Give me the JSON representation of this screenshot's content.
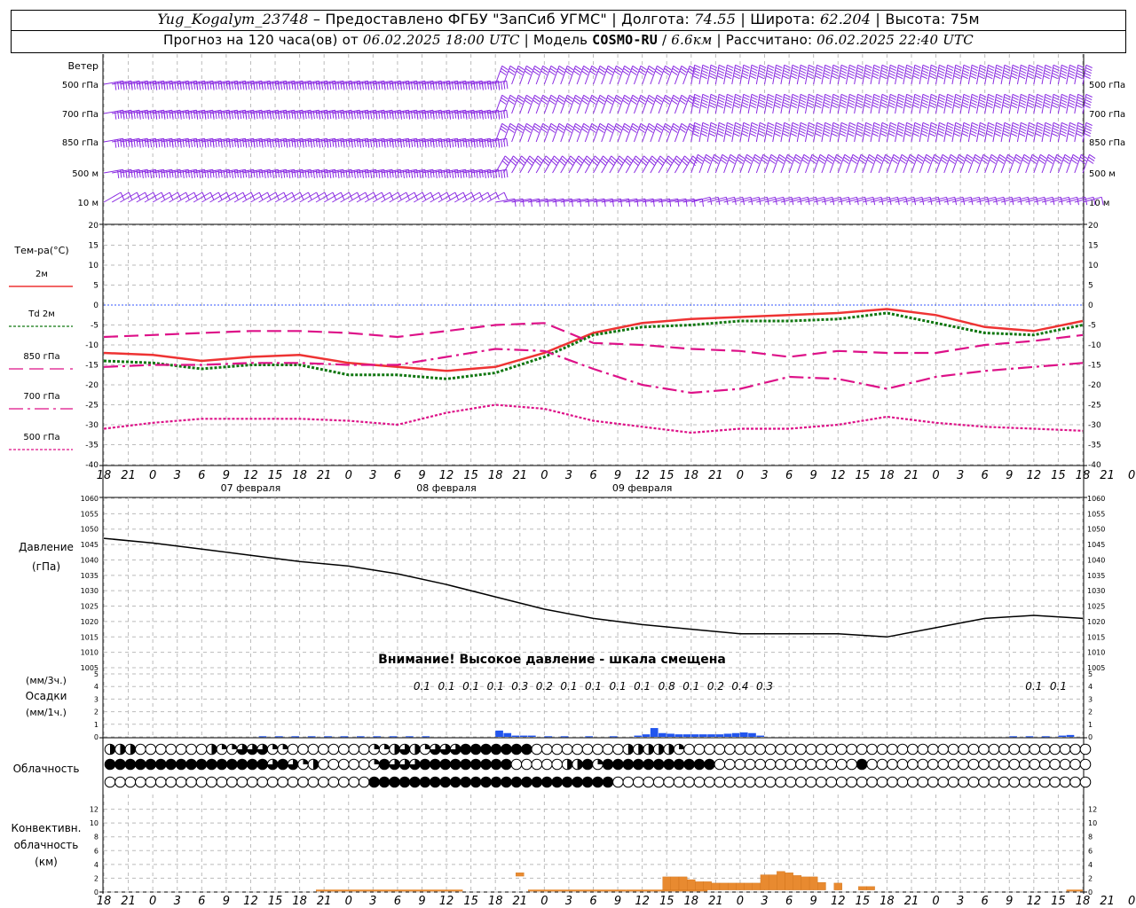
{
  "header": {
    "station": "Yug_Kogalym_23748",
    "provided_by": "Предоставлено ФГБУ \"ЗапСиб УГМС\"",
    "longitude_label": "Долгота:",
    "longitude": "74.55",
    "latitude_label": "Широта:",
    "latitude": "62.204",
    "altitude_label": "Высота:",
    "altitude": "75м",
    "forecast_label": "Прогноз на 120 часа(ов) от",
    "forecast_start": "06.02.2025 18:00 UTC",
    "model_label": "Модель",
    "model": "COSMO-RU",
    "resolution": "6.6км",
    "computed_label": "Рассчитано:",
    "computed": "06.02.2025 22:40 UTC"
  },
  "chart_data": [
    {
      "type": "wind-barbs",
      "panel_label": "Ветер",
      "levels": [
        "500 гПа",
        "700 гПа",
        "850 гПа",
        "500 м",
        "10 м"
      ],
      "line_color": "#8a2be2"
    },
    {
      "type": "line",
      "ylabel": "Тем-ра(°C)",
      "ylim": [
        -40,
        20
      ],
      "yticks": [
        20,
        15,
        10,
        5,
        0,
        -5,
        -10,
        -15,
        -20,
        -25,
        -30,
        -35,
        -40
      ],
      "x_hours": [
        0,
        6,
        12,
        18,
        24,
        30,
        36,
        42,
        48,
        54,
        60,
        66,
        72,
        78,
        84,
        90,
        96,
        102,
        108,
        114,
        120
      ],
      "series": [
        {
          "name": "2м",
          "color": "#ee3333",
          "dash": "solid",
          "values": [
            -12,
            -12.5,
            -14,
            -13,
            -12.5,
            -14.5,
            -15.5,
            -16.5,
            -15.5,
            -12,
            -7,
            -4.5,
            -3.5,
            -3,
            -2.5,
            -2,
            -1,
            -2.5,
            -5.5,
            -6.5,
            -4
          ]
        },
        {
          "name": "Td 2м",
          "color": "#117711",
          "dash": "dotted",
          "values": [
            -14,
            -14.5,
            -16,
            -15,
            -15,
            -17.5,
            -17.5,
            -18.5,
            -17,
            -13,
            -7.5,
            -5.5,
            -5,
            -4,
            -4,
            -3.5,
            -2,
            -4.5,
            -7,
            -7.5,
            -5
          ]
        },
        {
          "name": "850 гПа",
          "color": "#dd1188",
          "dash": "longdash",
          "values": [
            -8,
            -7.5,
            -7,
            -6.5,
            -6.5,
            -7,
            -8,
            -6.5,
            -5,
            -4.5,
            -9.5,
            -10,
            -11,
            -11.5,
            -13,
            -11.5,
            -12,
            -12,
            -10,
            -9,
            -7.5
          ]
        },
        {
          "name": "700 гПа",
          "color": "#dd1188",
          "dash": "dashdot",
          "values": [
            -15.5,
            -15,
            -15,
            -14.5,
            -14.5,
            -15,
            -15,
            -13,
            -11,
            -11.5,
            -16,
            -20,
            -22,
            -21,
            -18,
            -18.5,
            -21,
            -18,
            -16.5,
            -15.5,
            -14.5
          ]
        },
        {
          "name": "500 гПа",
          "color": "#dd1188",
          "dash": "dotted",
          "values": [
            -31,
            -29.5,
            -28.5,
            -28.5,
            -28.5,
            -29,
            -30,
            -27,
            -25,
            -26,
            -29,
            -30.5,
            -32,
            -31,
            -31,
            -30,
            -28,
            -29.5,
            -30.5,
            -31,
            -31.5
          ]
        }
      ]
    },
    {
      "type": "line",
      "ylabel": "Давление",
      "yunit": "(гПа)",
      "ylim": [
        1005,
        1060
      ],
      "yticks": [
        1060,
        1055,
        1050,
        1045,
        1040,
        1035,
        1030,
        1025,
        1020,
        1015,
        1010,
        1005
      ],
      "note": "Внимание! Высокое давление - шкала смещена",
      "x_hours": [
        0,
        6,
        12,
        18,
        24,
        30,
        36,
        42,
        48,
        54,
        60,
        66,
        72,
        78,
        84,
        90,
        96,
        102,
        108,
        114,
        120
      ],
      "series": [
        {
          "values": [
            1047,
            1045.5,
            1043.5,
            1041.5,
            1039.5,
            1038,
            1035.5,
            1032,
            1028,
            1024,
            1021,
            1019,
            1017.5,
            1016,
            1016,
            1016,
            1015,
            1018,
            1021,
            1022,
            1021
          ]
        }
      ],
      "color": "#000000"
    },
    {
      "type": "bar",
      "ylabel": "Осадки",
      "units_top": "(мм/3ч.)",
      "units_bottom": "(мм/1ч.)",
      "ylim": [
        0,
        5
      ],
      "yticks": [
        5,
        4,
        3,
        2,
        1,
        0
      ],
      "color": "#2255ee",
      "totals_3h": [
        {
          "hour": 39,
          "value": "0.1"
        },
        {
          "hour": 42,
          "value": "0.1"
        },
        {
          "hour": 45,
          "value": "0.1"
        },
        {
          "hour": 48,
          "value": "0.1"
        },
        {
          "hour": 51,
          "value": "0.3"
        },
        {
          "hour": 54,
          "value": "0.2"
        },
        {
          "hour": 57,
          "value": "0.1"
        },
        {
          "hour": 60,
          "value": "0.1"
        },
        {
          "hour": 63,
          "value": "0.1"
        },
        {
          "hour": 66,
          "value": "0.1"
        },
        {
          "hour": 69,
          "value": "0.8"
        },
        {
          "hour": 72,
          "value": "0.1"
        },
        {
          "hour": 75,
          "value": "0.2"
        },
        {
          "hour": 78,
          "value": "0.4"
        },
        {
          "hour": 81,
          "value": "0.3"
        },
        {
          "hour": 114,
          "value": "0.1"
        },
        {
          "hour": 117,
          "value": "0.1"
        }
      ],
      "hourly": [
        {
          "hour": 20,
          "value": 0.05
        },
        {
          "hour": 22,
          "value": 0.05
        },
        {
          "hour": 24,
          "value": 0.05
        },
        {
          "hour": 26,
          "value": 0.05
        },
        {
          "hour": 28,
          "value": 0.05
        },
        {
          "hour": 30,
          "value": 0.05
        },
        {
          "hour": 32,
          "value": 0.05
        },
        {
          "hour": 34,
          "value": 0.05
        },
        {
          "hour": 36,
          "value": 0.05
        },
        {
          "hour": 38,
          "value": 0.05
        },
        {
          "hour": 40,
          "value": 0.05
        },
        {
          "hour": 49,
          "value": 0.5
        },
        {
          "hour": 50,
          "value": 0.3
        },
        {
          "hour": 51,
          "value": 0.1
        },
        {
          "hour": 52,
          "value": 0.1
        },
        {
          "hour": 53,
          "value": 0.1
        },
        {
          "hour": 55,
          "value": 0.05
        },
        {
          "hour": 57,
          "value": 0.05
        },
        {
          "hour": 60,
          "value": 0.05
        },
        {
          "hour": 63,
          "value": 0.05
        },
        {
          "hour": 66,
          "value": 0.1
        },
        {
          "hour": 67,
          "value": 0.2
        },
        {
          "hour": 68,
          "value": 0.7
        },
        {
          "hour": 69,
          "value": 0.3
        },
        {
          "hour": 70,
          "value": 0.25
        },
        {
          "hour": 71,
          "value": 0.2
        },
        {
          "hour": 72,
          "value": 0.2
        },
        {
          "hour": 73,
          "value": 0.2
        },
        {
          "hour": 74,
          "value": 0.2
        },
        {
          "hour": 75,
          "value": 0.2
        },
        {
          "hour": 76,
          "value": 0.2
        },
        {
          "hour": 77,
          "value": 0.25
        },
        {
          "hour": 78,
          "value": 0.3
        },
        {
          "hour": 79,
          "value": 0.35
        },
        {
          "hour": 80,
          "value": 0.3
        },
        {
          "hour": 81,
          "value": 0.1
        },
        {
          "hour": 112,
          "value": 0.05
        },
        {
          "hour": 114,
          "value": 0.05
        },
        {
          "hour": 116,
          "value": 0.05
        },
        {
          "hour": 118,
          "value": 0.1
        },
        {
          "hour": 119,
          "value": 0.15
        }
      ]
    },
    {
      "type": "symbols",
      "ylabel": "Облачность",
      "rows": [
        "2220000000211333110000000011232133344444440000000002222210000000000000000000000000000000000000000",
        "4444444444444444343120000014333444444444000002241444444444440000000000000040000000000000000000000",
        "0000000000000000000000000044444444444444444444444400000000000000000000000000000000000000000000000"
      ]
    },
    {
      "type": "bar",
      "ylabel": "Конвективн.",
      "ylabel2": "облачность",
      "yunit": "(км)",
      "ylim": [
        0,
        14
      ],
      "yticks": [
        12,
        10,
        8,
        6,
        4,
        2,
        0
      ],
      "color": "#e88a30",
      "bars": [
        {
          "hour": 51,
          "bottom": 2.3,
          "top": 2.8
        },
        {
          "hour": 69,
          "bottom": 0.3,
          "top": 2.2
        },
        {
          "hour": 70,
          "bottom": 0.3,
          "top": 2.2
        },
        {
          "hour": 71,
          "bottom": 0.3,
          "top": 2.2
        },
        {
          "hour": 72,
          "bottom": 0.3,
          "top": 1.8
        },
        {
          "hour": 73,
          "bottom": 0.3,
          "top": 1.5
        },
        {
          "hour": 74,
          "bottom": 0.3,
          "top": 1.5
        },
        {
          "hour": 75,
          "bottom": 0.3,
          "top": 1.3
        },
        {
          "hour": 76,
          "bottom": 0.3,
          "top": 1.3
        },
        {
          "hour": 77,
          "bottom": 0.3,
          "top": 1.3
        },
        {
          "hour": 78,
          "bottom": 0.3,
          "top": 1.3
        },
        {
          "hour": 79,
          "bottom": 0.3,
          "top": 1.3
        },
        {
          "hour": 80,
          "bottom": 0.3,
          "top": 1.3
        },
        {
          "hour": 81,
          "bottom": 0.3,
          "top": 2.5
        },
        {
          "hour": 82,
          "bottom": 0.3,
          "top": 2.5
        },
        {
          "hour": 83,
          "bottom": 0.3,
          "top": 3.0
        },
        {
          "hour": 84,
          "bottom": 0.3,
          "top": 2.8
        },
        {
          "hour": 85,
          "bottom": 0.3,
          "top": 2.4
        },
        {
          "hour": 86,
          "bottom": 0.3,
          "top": 2.2
        },
        {
          "hour": 87,
          "bottom": 0.3,
          "top": 2.2
        },
        {
          "hour": 88,
          "bottom": 0.3,
          "top": 1.4
        },
        {
          "hour": 90,
          "bottom": 0.3,
          "top": 1.3
        },
        {
          "hour": 93,
          "bottom": 0.3,
          "top": 0.8
        },
        {
          "hour": 94,
          "bottom": 0.3,
          "top": 0.8
        }
      ],
      "thin_ranges": [
        [
          26,
          44
        ],
        [
          52,
          64
        ],
        [
          64,
          74
        ],
        [
          118,
          120
        ]
      ]
    }
  ],
  "x_axis": {
    "tick_labels": [
      "18",
      "21",
      "0",
      "3",
      "6",
      "9",
      "12",
      "15",
      "18",
      "21",
      "0",
      "3",
      "6",
      "9",
      "12",
      "15",
      "18",
      "21",
      "0",
      "3",
      "6",
      "9",
      "12",
      "15",
      "18",
      "21",
      "0",
      "3",
      "6",
      "9",
      "12",
      "15",
      "18",
      "21",
      "0",
      "3",
      "6",
      "9",
      "12",
      "15",
      "18",
      "21",
      "0"
    ],
    "dates": [
      "07 февраля",
      "08 февраля",
      "09 февраля"
    ]
  }
}
